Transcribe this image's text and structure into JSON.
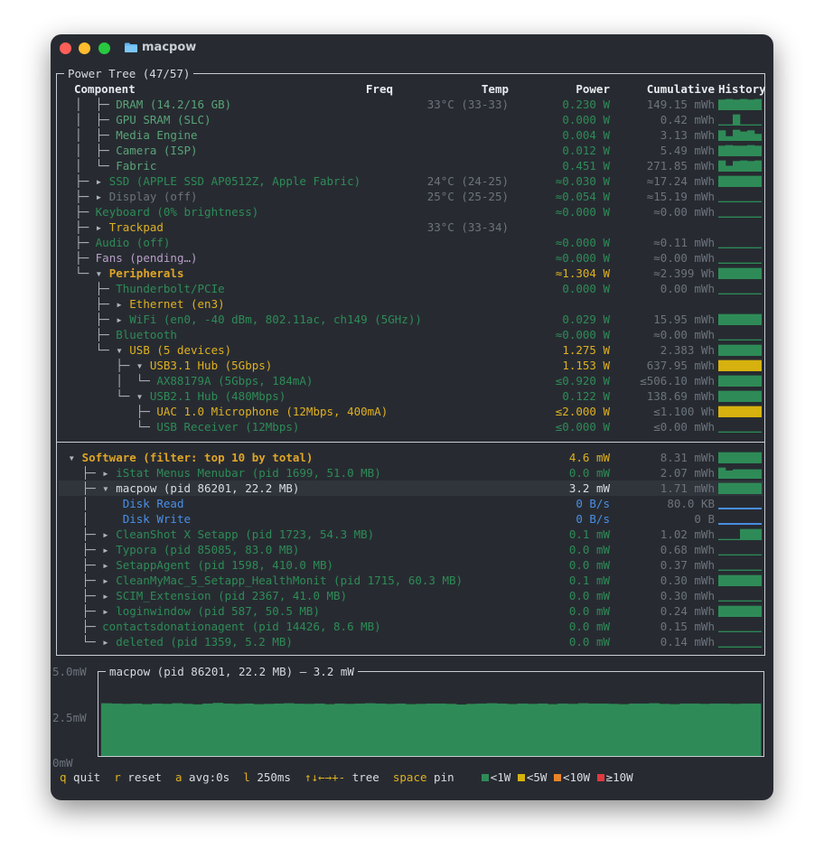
{
  "window": {
    "title": "macpow"
  },
  "tree_panel": {
    "title": "Power Tree (47/57)",
    "headers": {
      "component": "Component",
      "freq": "Freq",
      "temp": "Temp",
      "power": "Power",
      "cumulative": "Cumulative",
      "history": "History"
    },
    "rows": [
      {
        "prefix": "  │  ├─ ",
        "name": "DRAM (14.2/16 GB)",
        "style": "g2",
        "temp": "33°C (33-33)",
        "power": "0.230 W",
        "power_style": "g1",
        "cum": "149.15 mWh",
        "hist": [
          0.9,
          0.95,
          0.9,
          0.95,
          0.9,
          0.95
        ]
      },
      {
        "prefix": "  │  ├─ ",
        "name": "GPU SRAM (SLC)",
        "style": "g2",
        "temp": "",
        "power": "0.000 W",
        "power_style": "g1",
        "cum": "0.42 mWh",
        "hist": [
          0.1,
          0.1,
          0.95,
          0.1,
          0.1,
          0.1
        ]
      },
      {
        "prefix": "  │  ├─ ",
        "name": "Media Engine",
        "style": "g2",
        "temp": "",
        "power": "0.004 W",
        "power_style": "g1",
        "cum": "3.13 mWh",
        "hist": [
          0.9,
          0.4,
          0.95,
          0.8,
          0.9,
          0.6
        ]
      },
      {
        "prefix": "  │  ├─ ",
        "name": "Camera (ISP)",
        "style": "g2",
        "temp": "",
        "power": "0.012 W",
        "power_style": "g1",
        "cum": "5.49 mWh",
        "hist": [
          0.9,
          0.95,
          0.9,
          0.9,
          0.95,
          0.9
        ]
      },
      {
        "prefix": "  │  └─ ",
        "name": "Fabric",
        "style": "g2",
        "temp": "",
        "power": "0.451 W",
        "power_style": "g1",
        "cum": "271.85 mWh",
        "hist": [
          0.95,
          0.5,
          0.9,
          0.95,
          0.9,
          0.95
        ]
      },
      {
        "prefix": "  ├─ ▸ ",
        "name": "SSD (APPLE SSD AP0512Z, Apple Fabric)",
        "style": "g1",
        "temp": "24°C (24-25)",
        "power": "≈0.030 W",
        "power_style": "g1",
        "cum": "≈17.24 mWh",
        "hist": [
          0.95,
          0.95,
          0.95,
          0.95,
          0.95,
          0.95
        ]
      },
      {
        "prefix": "  ├─ ▸ ",
        "name": "Display (off)",
        "style": "dim",
        "temp": "25°C (25-25)",
        "power": "≈0.054 W",
        "power_style": "g1",
        "cum": "≈15.19 mWh",
        "hist": [
          0.1,
          0.1,
          0.1,
          0.1,
          0.1,
          0.1
        ]
      },
      {
        "prefix": "  ├─ ",
        "name": "Keyboard (0% brightness)",
        "style": "g1",
        "temp": "",
        "power": "≈0.000 W",
        "power_style": "g1",
        "cum": "≈0.00 mWh",
        "hist": [
          0.1,
          0.1,
          0.1,
          0.1,
          0.1,
          0.1
        ]
      },
      {
        "prefix": "  ├─ ▸ ",
        "name": "Trackpad",
        "style": "y",
        "temp": "33°C (33-34)",
        "power": "",
        "power_style": "g1",
        "cum": "",
        "hist": []
      },
      {
        "prefix": "  ├─ ",
        "name": "Audio (off)",
        "style": "g1",
        "temp": "",
        "power": "≈0.000 W",
        "power_style": "g1",
        "cum": "≈0.11 mWh",
        "hist": [
          0.1,
          0.1,
          0.1,
          0.1,
          0.1,
          0.1
        ]
      },
      {
        "prefix": "  ├─ ",
        "name": "Fans (pending…)",
        "style": "p",
        "temp": "",
        "power": "≈0.000 W",
        "power_style": "g1",
        "cum": "≈0.00 mWh",
        "hist": [
          0.1,
          0.1,
          0.1,
          0.1,
          0.1,
          0.1
        ]
      },
      {
        "prefix": "  └─ ▾ ",
        "name": "Peripherals",
        "style": "yb",
        "temp": "",
        "power": "≈1.304 W",
        "power_style": "y",
        "cum": "≈2.399 Wh",
        "hist": [
          0.95,
          0.95,
          0.95,
          0.95,
          0.95,
          0.95
        ]
      },
      {
        "prefix": "     ├─ ",
        "name": "Thunderbolt/PCIe",
        "style": "g1",
        "temp": "",
        "power": "0.000 W",
        "power_style": "g1",
        "cum": "0.00 mWh",
        "hist": [
          0.1,
          0.1,
          0.1,
          0.1,
          0.1,
          0.1
        ]
      },
      {
        "prefix": "     ├─ ▸ ",
        "name": "Ethernet (en3)",
        "style": "y",
        "temp": "",
        "power": "",
        "power_style": "g1",
        "cum": "",
        "hist": []
      },
      {
        "prefix": "     ├─ ▸ ",
        "name": "WiFi (en0, -40 dBm, 802.11ac, ch149 (5GHz))",
        "style": "g1",
        "temp": "",
        "power": "0.029 W",
        "power_style": "g1",
        "cum": "15.95 mWh",
        "hist": [
          0.95,
          0.95,
          0.95,
          0.95,
          0.95,
          0.95
        ]
      },
      {
        "prefix": "     ├─ ",
        "name": "Bluetooth",
        "style": "g1",
        "temp": "",
        "power": "≈0.000 W",
        "power_style": "g1",
        "cum": "≈0.00 mWh",
        "hist": [
          0.1,
          0.1,
          0.1,
          0.1,
          0.1,
          0.1
        ]
      },
      {
        "prefix": "     └─ ▾ ",
        "name": "USB (5 devices)",
        "style": "y",
        "temp": "",
        "power": "1.275 W",
        "power_style": "y",
        "cum": "2.383 Wh",
        "hist": [
          0.95,
          0.95,
          0.95,
          0.95,
          0.95,
          0.95
        ]
      },
      {
        "prefix": "        ├─ ▾ ",
        "name": "USB3.1 Hub (5Gbps)",
        "style": "y",
        "temp": "",
        "power": "1.153 W",
        "power_style": "y",
        "cum": "637.95 mWh",
        "hist": [
          0.95,
          0.95,
          0.95,
          0.95,
          0.95,
          0.95
        ],
        "hist_color": "#d7b20f"
      },
      {
        "prefix": "        │  └─ ",
        "name": "AX88179A (5Gbps, 184mA)",
        "style": "g1",
        "temp": "",
        "power": "≤0.920 W",
        "power_style": "g1",
        "cum": "≤506.10 mWh",
        "hist": [
          0.95,
          0.95,
          0.95,
          0.95,
          0.95,
          0.95
        ]
      },
      {
        "prefix": "        └─ ▾ ",
        "name": "USB2.1 Hub (480Mbps)",
        "style": "g1",
        "temp": "",
        "power": "0.122 W",
        "power_style": "g1",
        "cum": "138.69 mWh",
        "hist": [
          0.95,
          0.95,
          0.95,
          0.95,
          0.95,
          0.95
        ]
      },
      {
        "prefix": "           ├─ ",
        "name": "UAC 1.0 Microphone (12Mbps, 400mA)",
        "style": "y",
        "temp": "",
        "power": "≤2.000 W",
        "power_style": "y",
        "cum": "≤1.100 Wh",
        "hist": [
          0.95,
          0.95,
          0.95,
          0.95,
          0.95,
          0.95
        ],
        "hist_color": "#d7b20f"
      },
      {
        "prefix": "           └─ ",
        "name": "USB Receiver (12Mbps)",
        "style": "g1",
        "temp": "",
        "power": "≤0.000 W",
        "power_style": "g1",
        "cum": "≤0.00 mWh",
        "hist": [
          0.1,
          0.1,
          0.1,
          0.1,
          0.1,
          0.1
        ]
      },
      {
        "prefix": "",
        "name": "",
        "style": "g1",
        "temp": "",
        "power": "",
        "power_style": "g1",
        "cum": "",
        "hist": [],
        "separator": true
      },
      {
        "prefix": " ▾ ",
        "name": "Software (filter: top 10 by total)",
        "style": "yb",
        "temp": "",
        "power": "4.6 mW",
        "power_style": "y",
        "cum": "8.31 mWh",
        "hist": [
          0.95,
          0.95,
          0.95,
          0.95,
          0.95,
          0.95
        ]
      },
      {
        "prefix": "   ├─ ▸ ",
        "name": "iStat Menus Menubar (pid 1699, 51.0 MB)",
        "style": "g1",
        "temp": "",
        "power": "0.0 mW",
        "power_style": "g1",
        "cum": "2.07 mWh",
        "hist": [
          0.95,
          0.7,
          0.8,
          0.8,
          0.8,
          0.8
        ]
      },
      {
        "prefix": "   ├─ ▾ ",
        "name": "macpow (pid 86201, 22.2 MB)",
        "style": "w",
        "temp": "",
        "power": "3.2 mW",
        "power_style": "w",
        "cum": "1.71 mWh",
        "hist": [
          0.95,
          0.95,
          0.95,
          0.95,
          0.95,
          0.95
        ],
        "selected": true
      },
      {
        "prefix": "   │     ",
        "name": "Disk Read",
        "style": "b",
        "temp": "",
        "power": "0 B/s",
        "power_style": "b",
        "cum": "80.0 KB",
        "hist": [
          0.15,
          0.15,
          0.15,
          0.15,
          0.15,
          0.15
        ],
        "hist_color": "#4a8fe6"
      },
      {
        "prefix": "   │     ",
        "name": "Disk Write",
        "style": "b",
        "temp": "",
        "power": "0 B/s",
        "power_style": "b",
        "cum": "0 B",
        "hist": [
          0.15,
          0.15,
          0.15,
          0.15,
          0.15,
          0.15
        ],
        "hist_color": "#4a8fe6"
      },
      {
        "prefix": "   ├─ ▸ ",
        "name": "CleanShot X Setapp (pid 1723, 54.3 MB)",
        "style": "g1",
        "temp": "",
        "power": "0.1 mW",
        "power_style": "g1",
        "cum": "1.02 mWh",
        "hist": [
          0.1,
          0.1,
          0.1,
          0.95,
          0.95,
          0.95
        ]
      },
      {
        "prefix": "   ├─ ▸ ",
        "name": "Typora (pid 85085, 83.0 MB)",
        "style": "g1",
        "temp": "",
        "power": "0.0 mW",
        "power_style": "g1",
        "cum": "0.68 mWh",
        "hist": [
          0.1,
          0.1,
          0.1,
          0.1,
          0.1,
          0.1
        ]
      },
      {
        "prefix": "   ├─ ▸ ",
        "name": "SetappAgent (pid 1598, 410.0 MB)",
        "style": "g1",
        "temp": "",
        "power": "0.0 mW",
        "power_style": "g1",
        "cum": "0.37 mWh",
        "hist": [
          0.1,
          0.1,
          0.1,
          0.1,
          0.1,
          0.1
        ]
      },
      {
        "prefix": "   ├─ ▸ ",
        "name": "CleanMyMac_5_Setapp_HealthMonit (pid 1715, 60.3 MB)",
        "style": "g1",
        "temp": "",
        "power": "0.1 mW",
        "power_style": "g1",
        "cum": "0.30 mWh",
        "hist": [
          0.95,
          0.95,
          0.95,
          0.95,
          0.95,
          0.95
        ]
      },
      {
        "prefix": "   ├─ ▸ ",
        "name": "SCIM_Extension (pid 2367, 41.0 MB)",
        "style": "g1",
        "temp": "",
        "power": "0.0 mW",
        "power_style": "g1",
        "cum": "0.30 mWh",
        "hist": [
          0.1,
          0.1,
          0.1,
          0.1,
          0.1,
          0.1
        ]
      },
      {
        "prefix": "   ├─ ▸ ",
        "name": "loginwindow (pid 587, 50.5 MB)",
        "style": "g1",
        "temp": "",
        "power": "0.0 mW",
        "power_style": "g1",
        "cum": "0.24 mWh",
        "hist": [
          0.95,
          0.95,
          0.95,
          0.95,
          0.95,
          0.95
        ]
      },
      {
        "prefix": "   ├─ ",
        "name": "contactsdonationagent (pid 14426, 8.6 MB)",
        "style": "g1",
        "temp": "",
        "power": "0.0 mW",
        "power_style": "g1",
        "cum": "0.15 mWh",
        "hist": [
          0.1,
          0.1,
          0.1,
          0.1,
          0.1,
          0.1
        ]
      },
      {
        "prefix": "   └─ ▸ ",
        "name": "deleted (pid 1359, 5.2 MB)",
        "style": "g1",
        "temp": "",
        "power": "0.0 mW",
        "power_style": "g1",
        "cum": "0.14 mWh",
        "hist": [
          0.1,
          0.1,
          0.1,
          0.1,
          0.1,
          0.1
        ]
      }
    ]
  },
  "graph": {
    "title": "macpow (pid 86201, 22.2 MB) — 3.2 mW",
    "y_labels": {
      "top": "5.0mW",
      "mid": "2.5mW",
      "bottom": "0mW"
    },
    "ylim": [
      0,
      5.0
    ],
    "values": [
      3.32,
      3.3,
      3.28,
      3.3,
      3.26,
      3.3,
      3.28,
      3.32,
      3.28,
      3.25,
      3.3,
      3.34,
      3.3,
      3.28,
      3.3,
      3.26,
      3.28,
      3.3,
      3.32,
      3.29,
      3.28,
      3.3,
      3.26,
      3.3,
      3.28,
      3.3,
      3.32,
      3.3,
      3.28,
      3.3,
      3.26,
      3.28,
      3.3,
      3.3,
      3.28,
      3.24,
      3.28,
      3.3,
      3.32,
      3.3,
      3.27,
      3.3,
      3.28,
      3.3,
      3.26,
      3.3,
      3.28,
      3.32,
      3.3,
      3.3,
      3.28,
      3.26,
      3.3,
      3.3,
      3.32,
      3.28,
      3.26,
      3.3,
      3.3,
      3.28,
      3.3,
      3.3,
      3.28,
      3.3,
      3.3
    ],
    "color": "#2e8b57"
  },
  "footer": {
    "items": [
      {
        "key": "q",
        "label": " quit"
      },
      {
        "key": "r",
        "label": " reset"
      },
      {
        "key": "a",
        "label": " avg:0s"
      },
      {
        "key": "l",
        "label": " 250ms"
      },
      {
        "key": "↑↓←→+-",
        "label": " tree"
      },
      {
        "key": "space",
        "label": " pin"
      }
    ],
    "legend": [
      {
        "label": "<1W",
        "color": "#2e8b57"
      },
      {
        "label": "<5W",
        "color": "#d7b20f"
      },
      {
        "label": "<10W",
        "color": "#e8842a"
      },
      {
        "label": "≥10W",
        "color": "#e0393e"
      }
    ]
  }
}
